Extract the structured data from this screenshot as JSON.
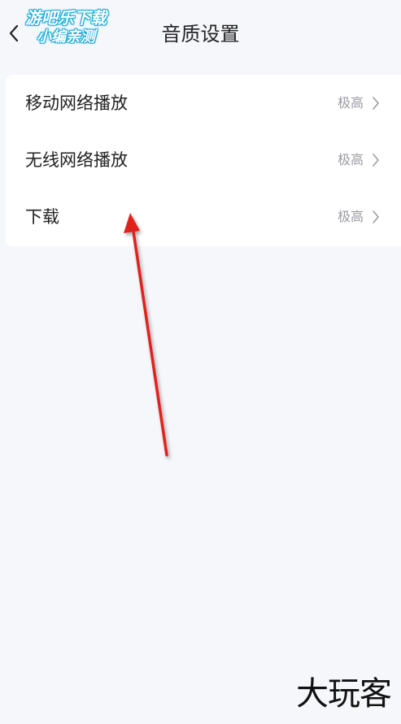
{
  "header": {
    "title": "音质设置",
    "back_icon": "chevron-left-icon"
  },
  "watermark_top": {
    "line1": "游吧乐下载",
    "line2": "小编亲测"
  },
  "settings": {
    "items": [
      {
        "label": "移动网络播放",
        "value": "极高",
        "icon": "chevron-right-icon"
      },
      {
        "label": "无线网络播放",
        "value": "极高",
        "icon": "chevron-right-icon"
      },
      {
        "label": "下载",
        "value": "极高",
        "icon": "chevron-right-icon"
      }
    ]
  },
  "annotation": {
    "arrow_color": "#e0201e"
  },
  "watermark_bottom": {
    "text": "大玩客"
  },
  "colors": {
    "background": "#f6f7fb",
    "card": "#ffffff",
    "value_text": "#9b9ba3",
    "watermark_outline": "#1aa8d8"
  }
}
